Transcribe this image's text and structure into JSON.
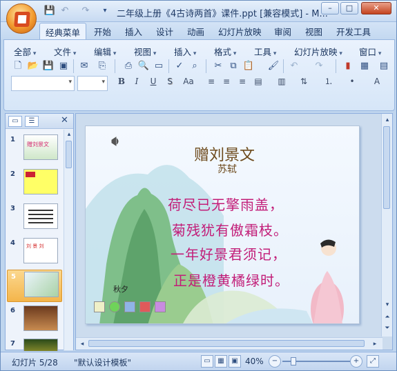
{
  "window": {
    "title": "二年级上册《4古诗两首》课件.ppt [兼容模式] - M...",
    "min": "–",
    "max": "□",
    "close": "✕"
  },
  "qat": {
    "save": "💾",
    "undo": "↶",
    "redo": "↷",
    "more": "▾"
  },
  "tabs": [
    "经典菜单",
    "开始",
    "插入",
    "设计",
    "动画",
    "幻灯片放映",
    "审阅",
    "视图",
    "开发工具"
  ],
  "ribbon": {
    "menus": [
      "全部",
      "文件",
      "编辑",
      "视图",
      "插入",
      "格式",
      "工具",
      "幻灯片放映",
      "窗口"
    ],
    "format": {
      "bold": "B",
      "italic": "I",
      "underline": "U",
      "strike": "S",
      "case": "Aa"
    }
  },
  "left_pane": {
    "tab_slides": "▭",
    "tab_outline": "☰",
    "close": "✕",
    "slides": [
      {
        "num": "1",
        "text": "赠刘景文"
      },
      {
        "num": "2",
        "text": ""
      },
      {
        "num": "3",
        "text": ""
      },
      {
        "num": "4",
        "text": "刘 景 刘"
      },
      {
        "num": "5",
        "text": ""
      },
      {
        "num": "6",
        "text": ""
      },
      {
        "num": "7",
        "text": ""
      }
    ],
    "selected": "5"
  },
  "slide": {
    "title": "赠刘景文",
    "author": "苏轼",
    "lines": [
      "荷尽已无擎雨盖，",
      "菊残犹有傲霜枝。",
      "一年好景君须记，",
      "正是橙黄橘绿时。"
    ],
    "caption": "秋夕"
  },
  "status": {
    "slide": "幻灯片 5/28",
    "theme": "\"默认设计模板\"",
    "zoom": "40%",
    "minus": "−",
    "plus": "+"
  },
  "colors": {
    "accent": "#c21d78",
    "title": "#6d4a1c",
    "selected": "#f4b54b"
  }
}
